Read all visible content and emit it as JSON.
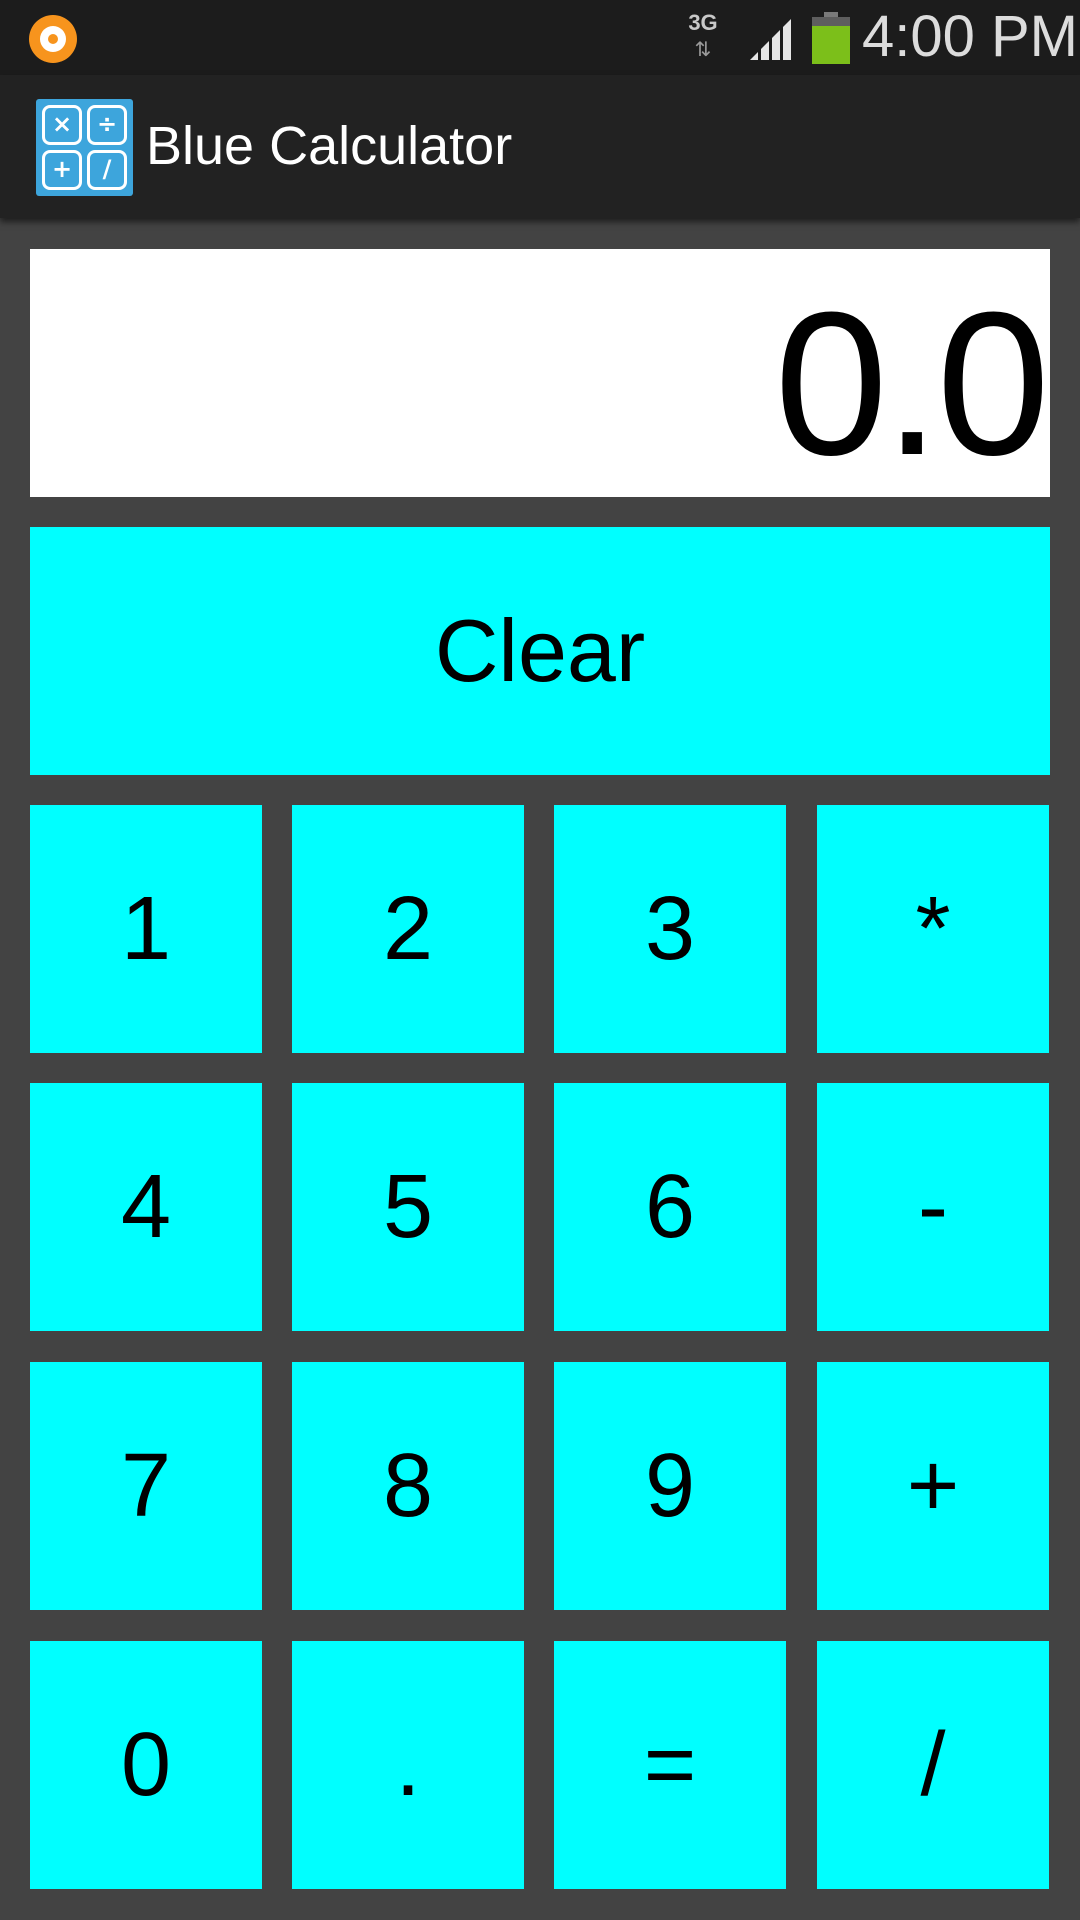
{
  "status_bar": {
    "network_type": "3G",
    "network_arrows": "⇅",
    "time": "4:00 PM",
    "battery_level": 0.8,
    "signal_bars": 4
  },
  "action_bar": {
    "app_icon_symbols": [
      "×",
      "÷",
      "+",
      "/"
    ],
    "title": "Blue Calculator"
  },
  "display": {
    "value": "0.0"
  },
  "buttons": {
    "clear": "Clear",
    "keys": [
      {
        "label": "1",
        "name": "key-1-button"
      },
      {
        "label": "2",
        "name": "key-2-button"
      },
      {
        "label": "3",
        "name": "key-3-button"
      },
      {
        "label": "*",
        "name": "multiply-button"
      },
      {
        "label": "4",
        "name": "key-4-button"
      },
      {
        "label": "5",
        "name": "key-5-button"
      },
      {
        "label": "6",
        "name": "key-6-button"
      },
      {
        "label": "-",
        "name": "subtract-button"
      },
      {
        "label": "7",
        "name": "key-7-button"
      },
      {
        "label": "8",
        "name": "key-8-button"
      },
      {
        "label": "9",
        "name": "key-9-button"
      },
      {
        "label": "+",
        "name": "add-button"
      },
      {
        "label": "0",
        "name": "key-0-button"
      },
      {
        "label": ".",
        "name": "decimal-button"
      },
      {
        "label": "=",
        "name": "equals-button"
      },
      {
        "label": "/",
        "name": "divide-button"
      }
    ]
  },
  "colors": {
    "button_bg": "#00ffff",
    "background": "#434343",
    "action_bar": "#222222",
    "status_bar": "#1c1c1c",
    "battery_fill": "#7cbf1a",
    "app_icon": "#3da5dc"
  }
}
